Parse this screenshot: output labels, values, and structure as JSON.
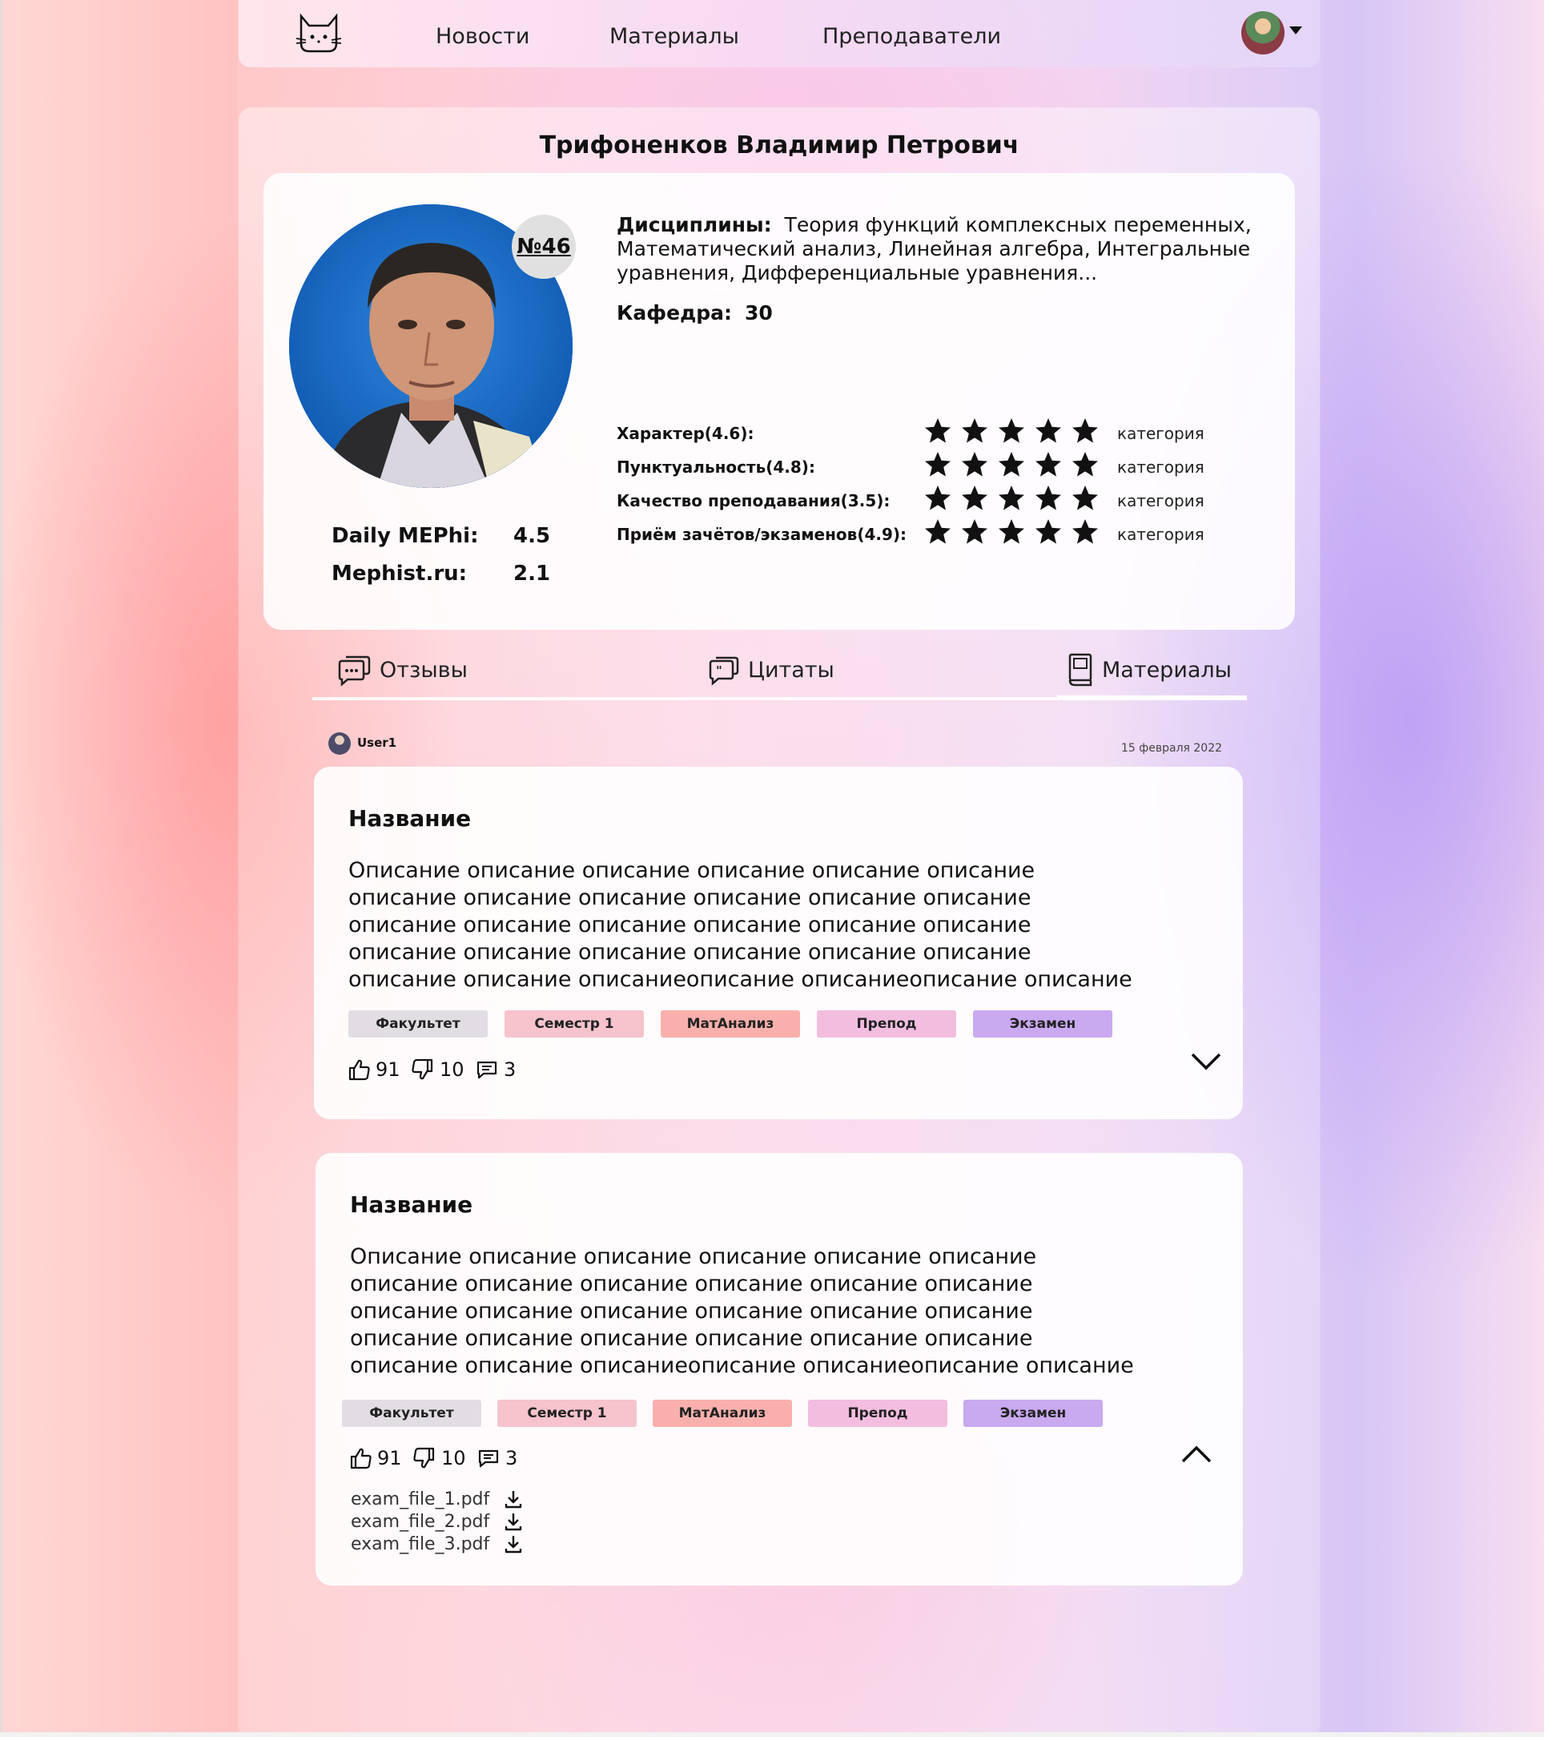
{
  "nav": {
    "links": [
      "Новости",
      "Материалы",
      "Преподаватели"
    ]
  },
  "teacher": {
    "name": "Трифоненков Владимир Петрович",
    "rank": "№46",
    "disciplines_label": "Дисциплины:",
    "disciplines": "Теория функций комплексных переменных, Математический анализ, Линейная алгебра, Интегральные уравнения, Дифференциальные уравнения...",
    "department_label": "Кафедра:",
    "department": "30",
    "external_ratings": [
      {
        "label": "Daily MEPhi:",
        "value": "4.5"
      },
      {
        "label": "Mephist.ru:",
        "value": "2.1"
      }
    ],
    "ratings": [
      {
        "label": "Характер(4.6):",
        "category": "категория",
        "stars": 5
      },
      {
        "label": "Пунктуальность(4.8):",
        "category": "категория",
        "stars": 5
      },
      {
        "label": "Качество преподавания(3.5):",
        "category": "категория",
        "stars": 5
      },
      {
        "label": "Приём зачётов/экзаменов(4.9):",
        "category": "категория",
        "stars": 5
      }
    ]
  },
  "tabs": [
    {
      "label": "Отзывы",
      "icon": "chat-bubble-icon"
    },
    {
      "label": "Цитаты",
      "icon": "quote-bubble-icon"
    },
    {
      "label": "Материалы",
      "icon": "book-icon",
      "active": true
    }
  ],
  "post": {
    "author": "User1",
    "date": "15 февраля 2022"
  },
  "materials": [
    {
      "title": "Название",
      "description": "Описание описание описание описание описание описание описание описание описание описание описание описание описание описание описание описание описание описание описание описание описание описание описание описание описание описание описаниеописание описаниеописание описание",
      "tags": [
        "Факультет",
        "Семестр 1",
        "МатАнализ",
        "Препод",
        "Экзамен"
      ],
      "likes": "91",
      "dislikes": "10",
      "comments": "3",
      "expanded": false,
      "files": []
    },
    {
      "title": "Название",
      "description": "Описание описание описание описание описание описание описание описание описание описание описание описание описание описание описание описание описание описание описание описание описание описание описание описание описание описание описаниеописание описаниеописание описание",
      "tags": [
        "Факультет",
        "Семестр 1",
        "МатАнализ",
        "Препод",
        "Экзамен"
      ],
      "likes": "91",
      "dislikes": "10",
      "comments": "3",
      "expanded": true,
      "files": [
        "exam_file_1.pdf",
        "exam_file_2.pdf",
        "exam_file_3.pdf"
      ]
    }
  ],
  "colors": {
    "tag_faculty": "#e2dde3",
    "tag_semester": "#f7c3cd",
    "tag_subject": "#f9b0ad",
    "tag_teacher": "#f3bde0",
    "tag_exam": "#c9a9f0",
    "photo_background": "#1c6fc8"
  }
}
